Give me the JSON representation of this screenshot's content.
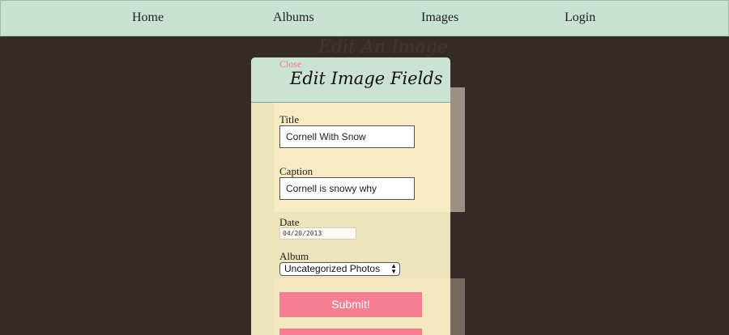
{
  "nav": {
    "items": [
      {
        "label": "Home"
      },
      {
        "label": "Albums"
      },
      {
        "label": "Images"
      },
      {
        "label": "Login"
      }
    ]
  },
  "page": {
    "heading": "Edit An Image"
  },
  "modal": {
    "close_label": "Close",
    "title": "Edit Image Fields",
    "fields": {
      "title": {
        "label": "Title",
        "value": "Cornell With Snow"
      },
      "caption": {
        "label": "Caption",
        "value": "Cornell is snowy why"
      },
      "date": {
        "label": "Date",
        "value": "04/20/2013"
      },
      "album": {
        "label": "Album",
        "selected": "Uncategorized Photos"
      }
    },
    "submit_label": "Submit!"
  },
  "colors": {
    "navbar_bg": "#c9e2d3",
    "page_bg": "#352b29",
    "modal_bg": "#fdf2c7",
    "accent_pink": "#f57f92",
    "close_pink": "#f07b8c"
  }
}
